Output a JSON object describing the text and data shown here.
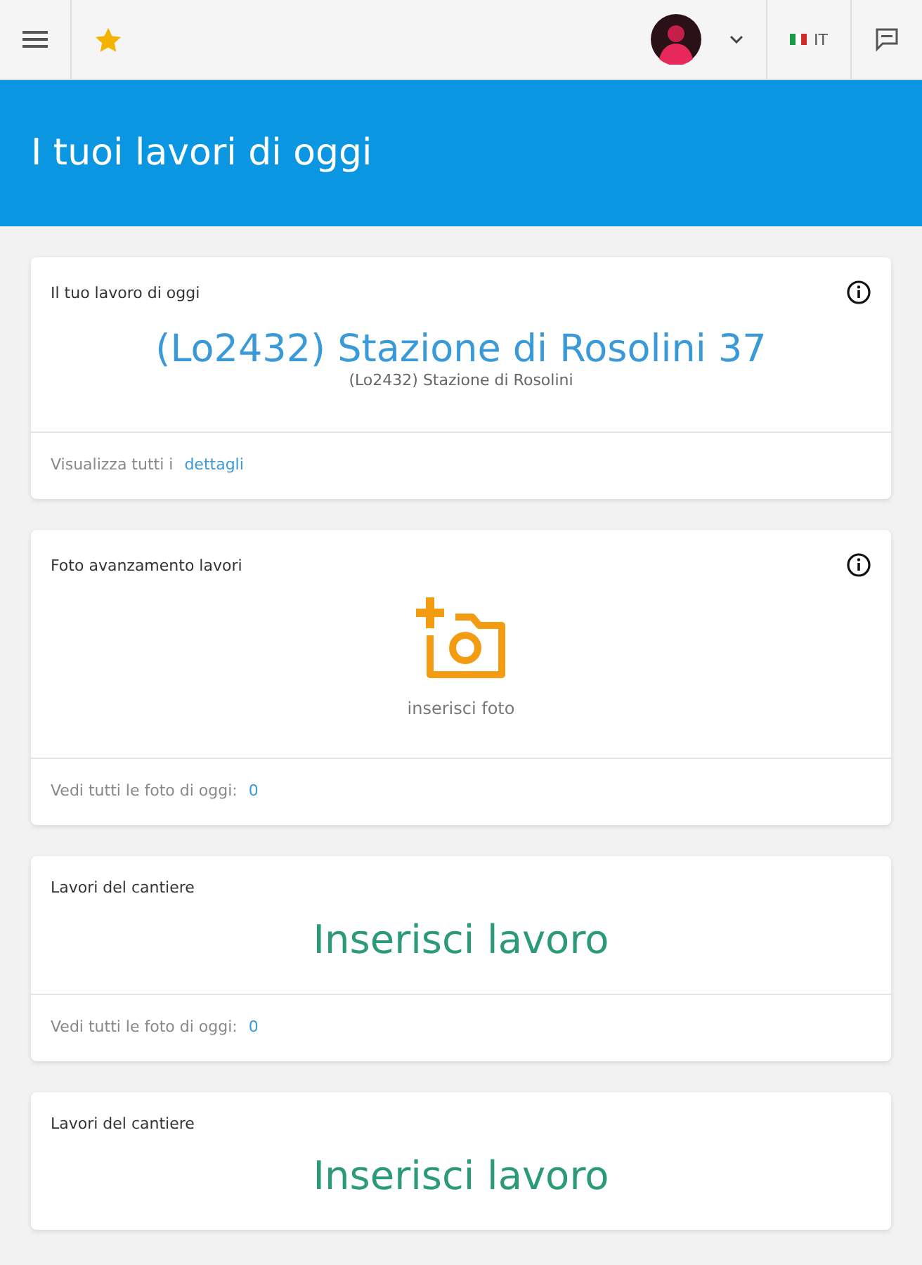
{
  "topbar": {
    "language": "IT"
  },
  "hero": {
    "title": "I tuoi lavori di oggi"
  },
  "cards": [
    {
      "kind": "job",
      "header": "Il tuo lavoro di oggi",
      "info": true,
      "title": "(Lo2432) Stazione di Rosolini 37",
      "subtitle": "(Lo2432) Stazione di Rosolini",
      "footer_text": "Visualizza tutti i",
      "footer_link": "dettagli"
    },
    {
      "kind": "photo",
      "header": "Foto avanzamento lavori",
      "info": true,
      "action": "inserisci foto",
      "footer_text": "Vedi tutti le foto di oggi:",
      "footer_link": "0"
    },
    {
      "kind": "work",
      "header": "Lavori del cantiere",
      "info": false,
      "title": "Inserisci lavoro",
      "footer_text": "Vedi tutti le foto di oggi:",
      "footer_link": "0"
    },
    {
      "kind": "work",
      "header": "Lavori del cantiere",
      "info": false,
      "title": "Inserisci lavoro"
    }
  ]
}
